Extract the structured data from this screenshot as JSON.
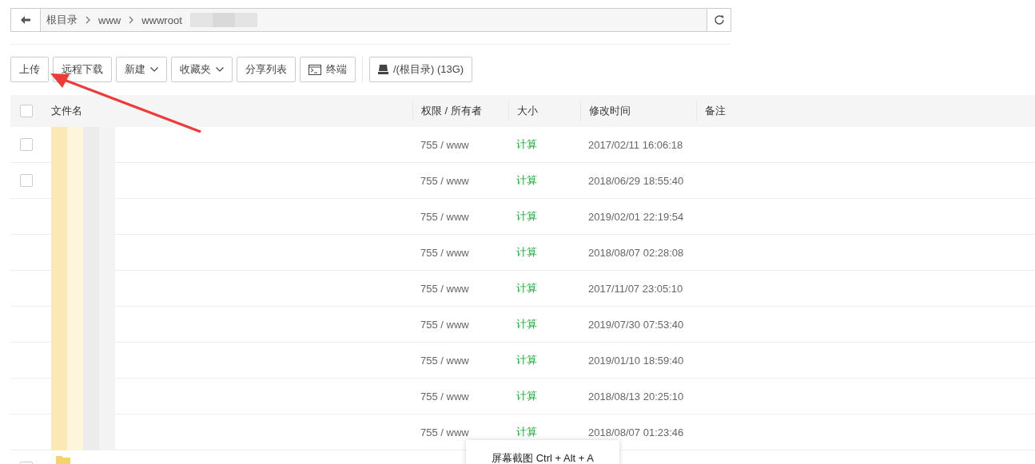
{
  "path_bar": {
    "crumbs": [
      "根目录",
      "www",
      "wwwroot"
    ]
  },
  "toolbar": [
    {
      "label": "上传",
      "kind": "plain"
    },
    {
      "label": "远程下载",
      "kind": "plain"
    },
    {
      "label": "新建",
      "kind": "dropdown"
    },
    {
      "label": "收藏夹",
      "kind": "dropdown"
    },
    {
      "label": "分享列表",
      "kind": "plain"
    },
    {
      "label": "终端",
      "kind": "terminal"
    },
    {
      "label": "/(根目录) (13G)",
      "kind": "disk"
    }
  ],
  "table": {
    "select_all": {
      "checked": false
    },
    "columns": [
      "文件名",
      "权限 / 所有者",
      "大小",
      "修改时间",
      "备注"
    ],
    "rows": [
      {
        "checked": false,
        "permissions": "755 / www",
        "size": "计算",
        "modified": "2017/02/11 16:06:18"
      },
      {
        "checked": false,
        "permissions": "755 / www",
        "size": "计算",
        "modified": "2018/06/29 18:55:40"
      },
      {
        "permissions": "755 / www",
        "size": "计算",
        "modified": "2019/02/01 22:19:54"
      },
      {
        "permissions": "755 / www",
        "size": "计算",
        "modified": "2018/08/07 02:28:08"
      },
      {
        "permissions": "755 / www",
        "size": "计算",
        "modified": "2017/11/07 23:05:10"
      },
      {
        "permissions": "755 / www",
        "size": "计算",
        "modified": "2019/07/30 07:53:40"
      },
      {
        "permissions": "755 / www",
        "size": "计算",
        "modified": "2019/01/10 18:59:40"
      },
      {
        "permissions": "755 / www",
        "size": "计算",
        "modified": "2018/08/13 20:25:10"
      },
      {
        "permissions": "755 / www",
        "size": "计算",
        "modified": "2018/08/07 01:23:46"
      },
      {
        "checked": false
      }
    ]
  },
  "tooltip": "屏幕截图 Ctrl + Alt + A"
}
